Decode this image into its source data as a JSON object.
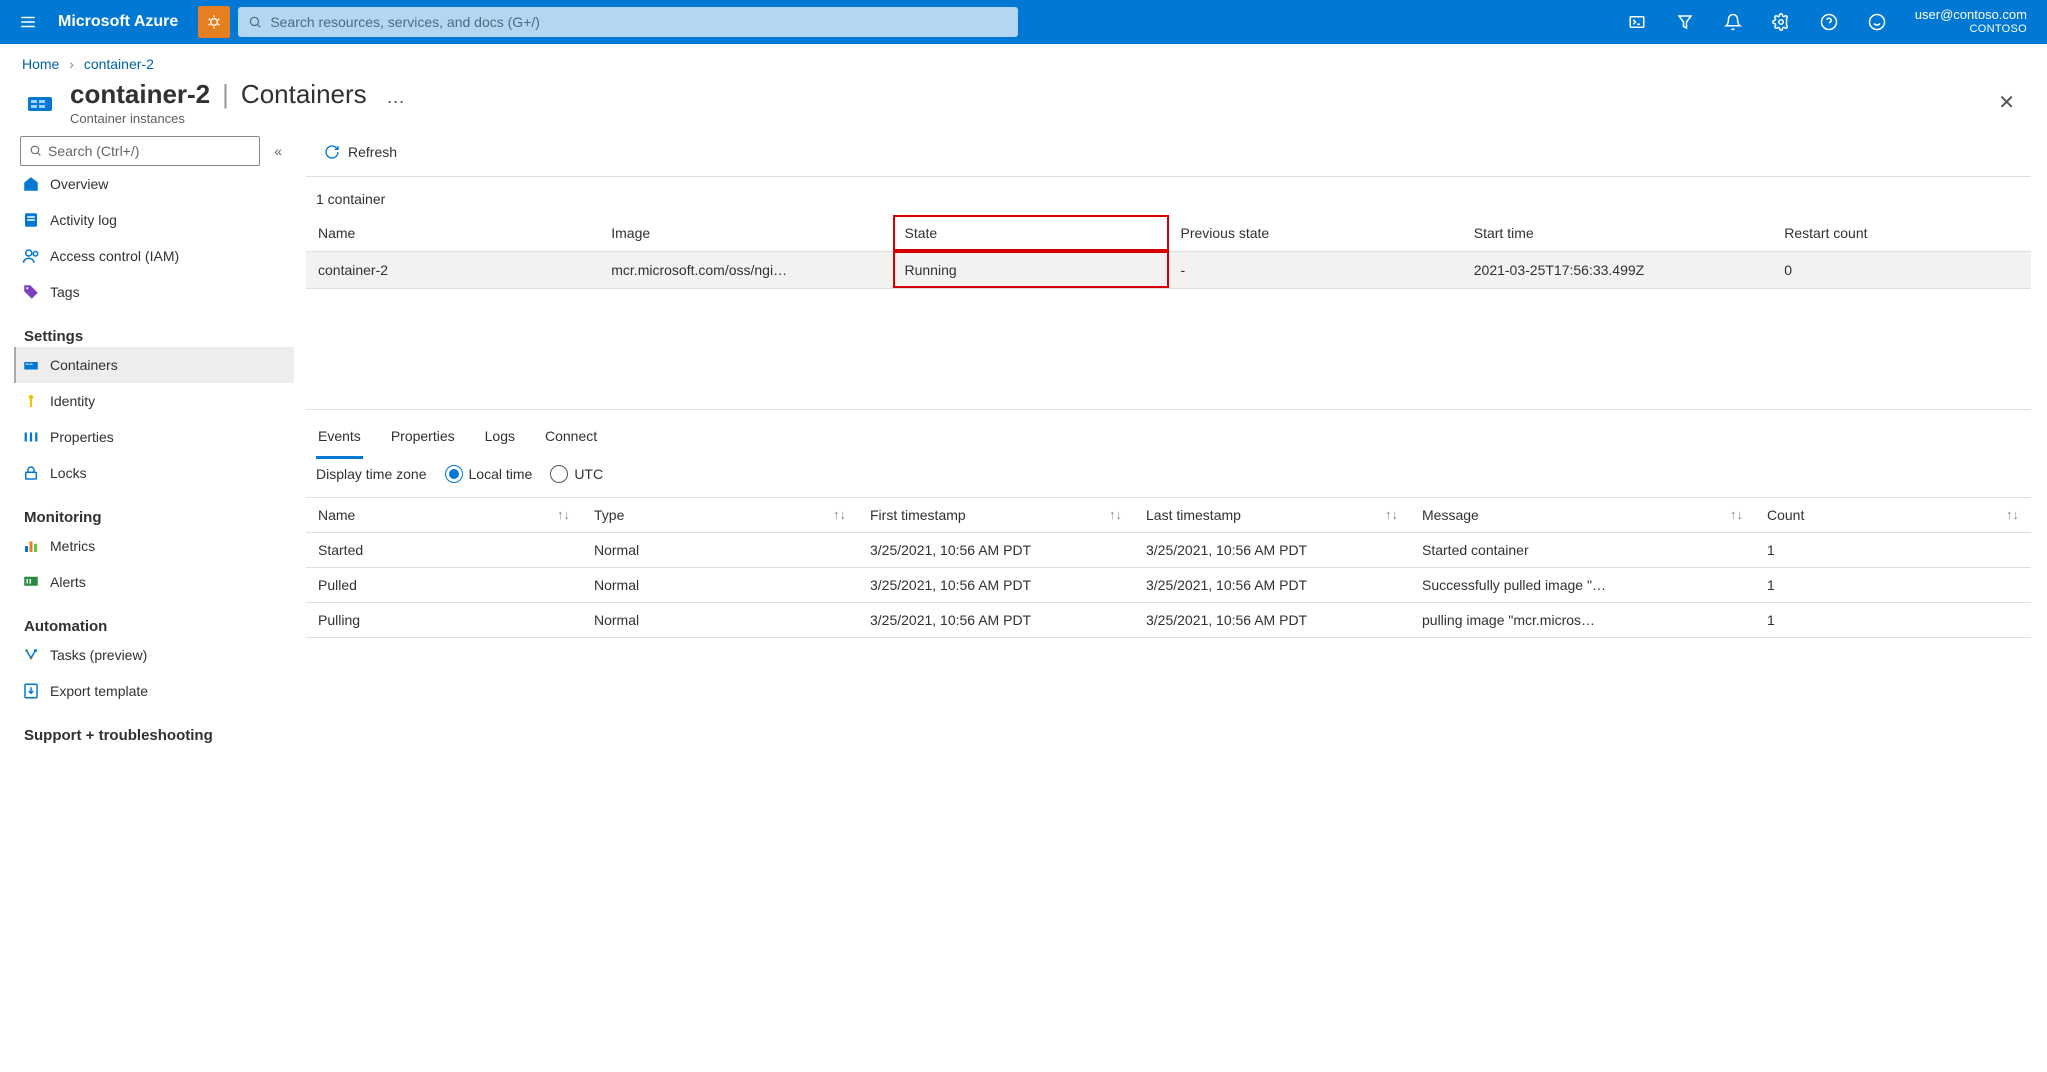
{
  "topbar": {
    "brand": "Microsoft Azure",
    "search_placeholder": "Search resources, services, and docs (G+/)",
    "account_email": "user@contoso.com",
    "account_tenant": "CONTOSO"
  },
  "breadcrumb": {
    "home": "Home",
    "current": "container-2"
  },
  "header": {
    "resource_name": "container-2",
    "section": "Containers",
    "subtitle": "Container instances"
  },
  "sidebar": {
    "search_placeholder": "Search (Ctrl+/)",
    "items_top": [
      {
        "label": "Overview"
      },
      {
        "label": "Activity log"
      },
      {
        "label": "Access control (IAM)"
      },
      {
        "label": "Tags"
      }
    ],
    "group_settings": "Settings",
    "items_settings": [
      {
        "label": "Containers"
      },
      {
        "label": "Identity"
      },
      {
        "label": "Properties"
      },
      {
        "label": "Locks"
      }
    ],
    "group_monitoring": "Monitoring",
    "items_monitoring": [
      {
        "label": "Metrics"
      },
      {
        "label": "Alerts"
      }
    ],
    "group_automation": "Automation",
    "items_automation": [
      {
        "label": "Tasks (preview)"
      },
      {
        "label": "Export template"
      }
    ],
    "group_support": "Support + troubleshooting"
  },
  "toolbar": {
    "refresh": "Refresh"
  },
  "containers": {
    "count_label": "1 container",
    "columns": {
      "name": "Name",
      "image": "Image",
      "state": "State",
      "previous_state": "Previous state",
      "start_time": "Start time",
      "restart_count": "Restart count"
    },
    "rows": [
      {
        "name": "container-2",
        "image": "mcr.microsoft.com/oss/ngi…",
        "state": "Running",
        "previous_state": "-",
        "start_time": "2021-03-25T17:56:33.499Z",
        "restart_count": "0"
      }
    ]
  },
  "detailTabs": {
    "events": "Events",
    "properties": "Properties",
    "logs": "Logs",
    "connect": "Connect"
  },
  "timezone": {
    "label": "Display time zone",
    "local": "Local time",
    "utc": "UTC"
  },
  "events": {
    "columns": {
      "name": "Name",
      "type": "Type",
      "first": "First timestamp",
      "last": "Last timestamp",
      "message": "Message",
      "count": "Count"
    },
    "rows": [
      {
        "name": "Started",
        "type": "Normal",
        "first": "3/25/2021, 10:56 AM PDT",
        "last": "3/25/2021, 10:56 AM PDT",
        "message": "Started container",
        "count": "1"
      },
      {
        "name": "Pulled",
        "type": "Normal",
        "first": "3/25/2021, 10:56 AM PDT",
        "last": "3/25/2021, 10:56 AM PDT",
        "message": "Successfully pulled image \"…",
        "count": "1"
      },
      {
        "name": "Pulling",
        "type": "Normal",
        "first": "3/25/2021, 10:56 AM PDT",
        "last": "3/25/2021, 10:56 AM PDT",
        "message": "pulling image \"mcr.micros…",
        "count": "1"
      }
    ]
  }
}
